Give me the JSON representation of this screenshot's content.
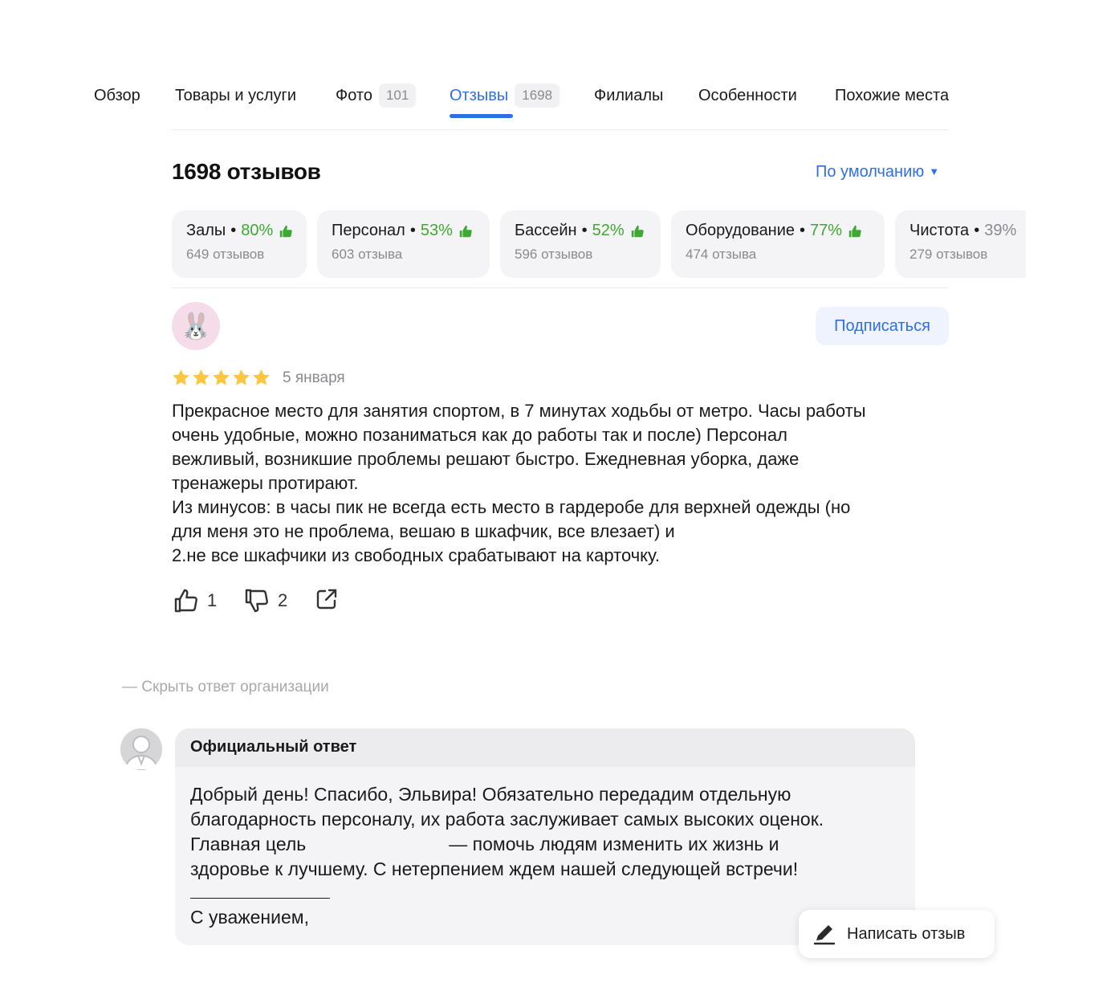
{
  "tabs": [
    {
      "label": "Обзор"
    },
    {
      "label": "Товары и услуги"
    },
    {
      "label": "Фото",
      "badge": "101"
    },
    {
      "label": "Отзывы",
      "badge": "1698"
    },
    {
      "label": "Филиалы"
    },
    {
      "label": "Особенности"
    },
    {
      "label": "Похожие места"
    }
  ],
  "active_tab": "Отзывы",
  "reviews_header": {
    "count_title": "1698 отзывов",
    "sort_label": "По умолчанию"
  },
  "aspects": [
    {
      "name": "Залы",
      "percent": "80%",
      "reviews": "649 отзывов"
    },
    {
      "name": "Персонал",
      "percent": "53%",
      "reviews": "603 отзыва"
    },
    {
      "name": "Бассейн",
      "percent": "52%",
      "reviews": "596 отзывов"
    },
    {
      "name": "Оборудование",
      "percent": "77%",
      "reviews": "474 отзыва"
    },
    {
      "name": "Чистота",
      "percent": "39%",
      "reviews": "279 отзывов"
    }
  ],
  "review": {
    "avatar_emoji": "🐰",
    "subscribe_label": "Подписаться",
    "rating": 5,
    "date": "5 января",
    "text": "Прекрасное место для занятия спортом, в 7 минутах ходьбы от метро. Часы работы\nочень удобные, можно позаниматься как до работы так и после) Персонал\nвежливый, возникшие проблемы решают быстро. Ежедневная уборка, даже\nтренажеры протирают.\nИз минусов: в часы пик не всегда есть место в гардеробе для верхней одежды (но\nдля меня это не проблема, вешаю в шкафчик, все влезает) и\n2.не все шкафчики из свободных срабатывают на карточку.",
    "likes": "1",
    "dislikes": "2"
  },
  "org_reply": {
    "hide_label": "— Скрыть ответ организации",
    "title": "Официальный ответ",
    "line1": "Добрый день! Спасибо, Эльвира! Обязательно передадим отдельную",
    "line2": "благодарность персоналу, их работа заслуживает самых высоких оценок.",
    "line3a": "Главная цель",
    "line3b": "— помочь людям изменить их жизнь и",
    "line4": "здоровье к лучшему. С нетерпением ждем нашей следующей встречи!",
    "signoff": "С уважением,"
  },
  "write_review_label": "Написать отзыв",
  "colors": {
    "accent": "#2f6fe6",
    "positive": "#3ea932",
    "star": "#fbc740",
    "muted": "#8a8a8e"
  }
}
